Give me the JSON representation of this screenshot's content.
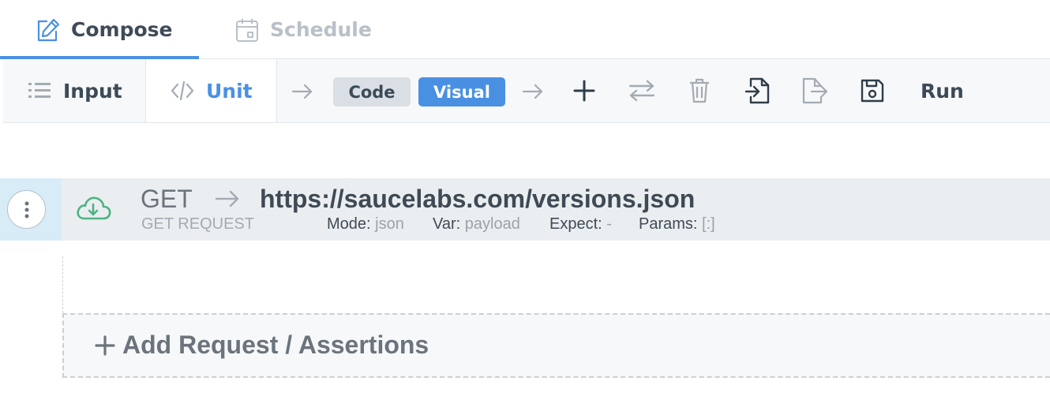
{
  "top_tabs": [
    {
      "label": "Compose",
      "icon": "edit-icon",
      "active": true
    },
    {
      "label": "Schedule",
      "icon": "calendar-icon",
      "active": false
    }
  ],
  "toolbar": {
    "input_label": "Input",
    "unit_label": "Unit",
    "code_label": "Code",
    "visual_label": "Visual",
    "run_label": "Run",
    "icons": [
      "arrow-right-icon",
      "plus-icon",
      "swap-icon",
      "trash-icon",
      "import-icon",
      "export-icon",
      "save-icon"
    ]
  },
  "request": {
    "method": "GET",
    "url": "https://saucelabs.com/versions.json",
    "type_label": "GET REQUEST",
    "mode_key": "Mode:",
    "mode_value": "json",
    "var_key": "Var:",
    "var_value": "payload",
    "expect_key": "Expect:",
    "expect_value": "-",
    "params_key": "Params:",
    "params_value": "[:]"
  },
  "add_label": "Add Request / Assertions",
  "colors": {
    "accent": "#4a90e2",
    "cloud": "#4db385",
    "gutter": "#d8ecf8"
  }
}
